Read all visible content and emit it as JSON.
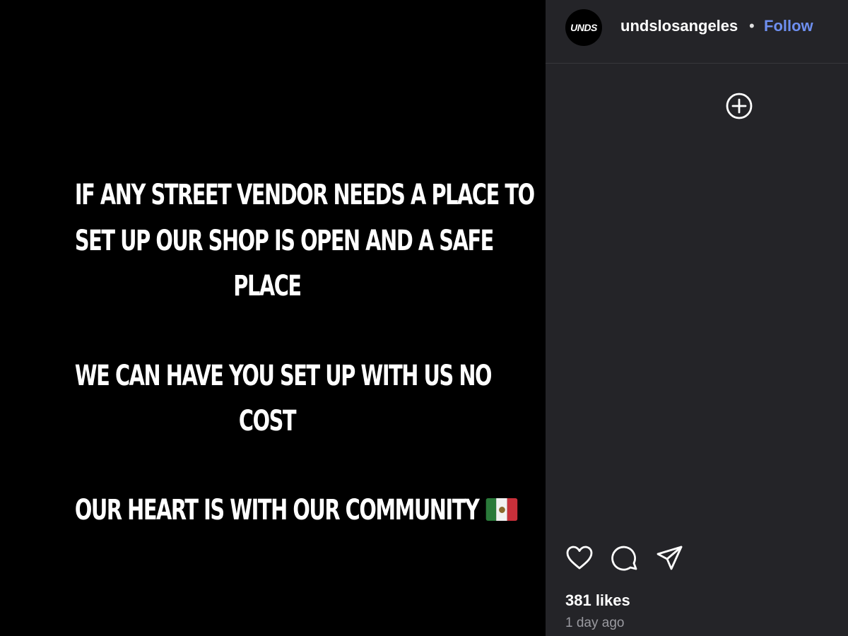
{
  "post": {
    "lines": [
      "IF ANY STREET VENDOR NEEDS A PLACE TO",
      "SET UP OUR SHOP IS OPEN AND A SAFE",
      "PLACE",
      "WE CAN HAVE YOU SET UP WITH US NO",
      "COST",
      "OUR HEART IS WITH OUR COMMUNITY"
    ],
    "flag": "mexico-flag-emoji"
  },
  "header": {
    "avatar_text": "UNDS",
    "username": "undslosangeles",
    "separator": "•",
    "follow_label": "Follow"
  },
  "actions": {
    "icons": [
      "plus-circle-icon",
      "heart-icon",
      "comment-icon",
      "share-icon"
    ]
  },
  "stats": {
    "likes": "381 likes",
    "time": "1 day ago"
  },
  "colors": {
    "panel_bg": "#242428",
    "media_bg": "#000000",
    "follow": "#6e8ff0",
    "muted": "#9a9aa0"
  }
}
